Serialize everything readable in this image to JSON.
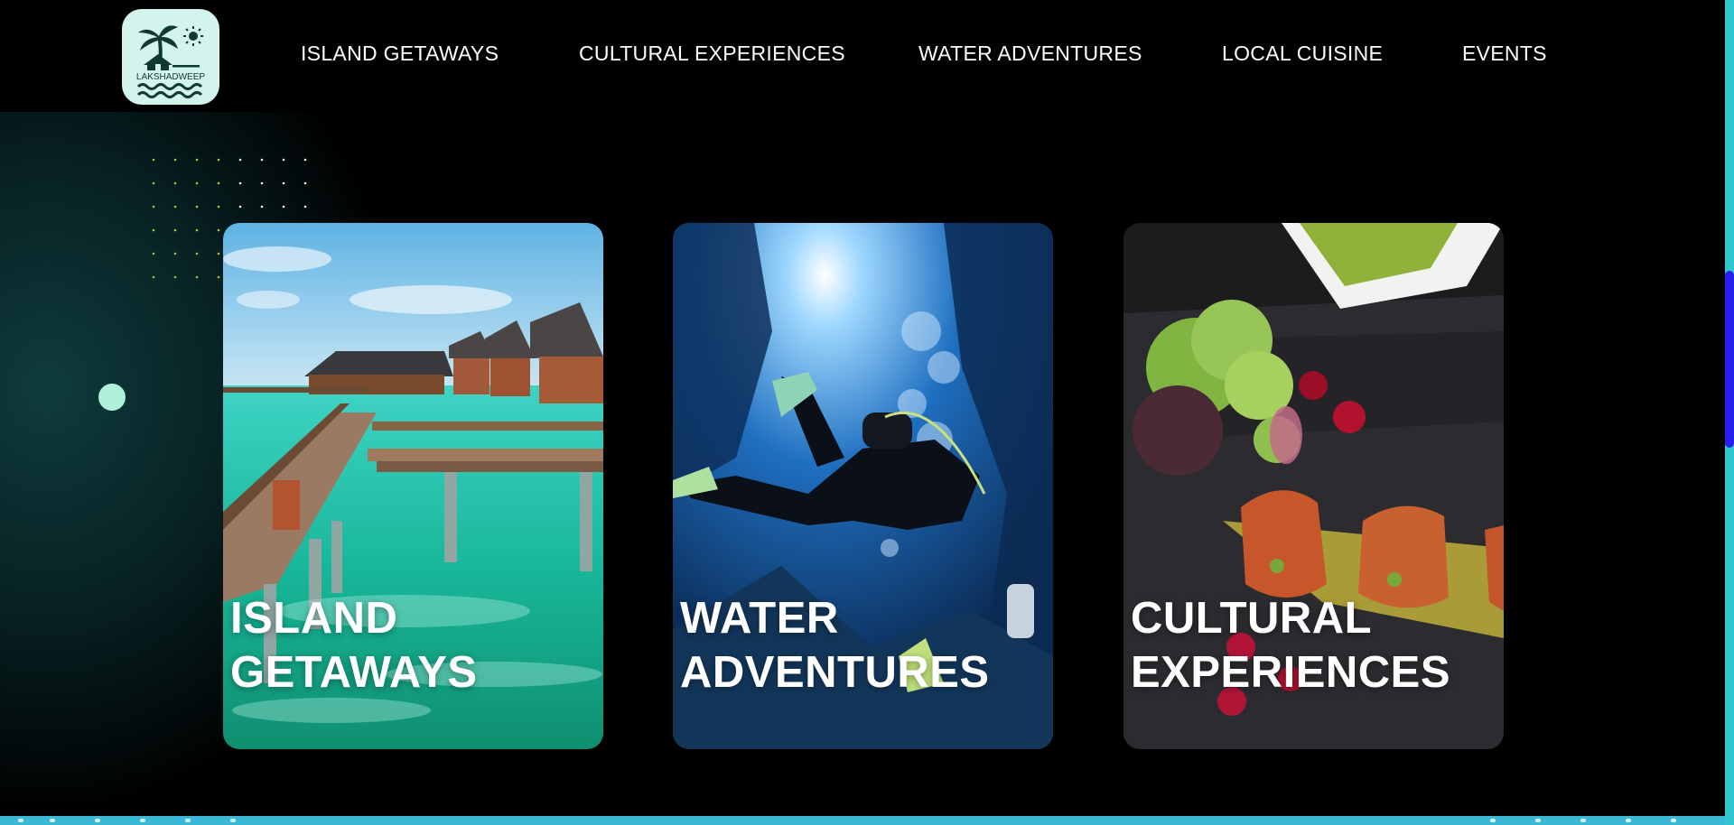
{
  "brand": {
    "logo_text": "LAKSHADWEEP"
  },
  "nav": {
    "items": [
      {
        "label": "ISLAND GETAWAYS"
      },
      {
        "label": "CULTURAL EXPERIENCES"
      },
      {
        "label": "WATER ADVENTURES"
      },
      {
        "label": "LOCAL CUISINE"
      },
      {
        "label": "EVENTS"
      }
    ]
  },
  "cards": [
    {
      "line1": "ISLAND",
      "line2": "GETAWAYS",
      "image": "overwater-villas-photo"
    },
    {
      "line1": "WATER",
      "line2": "ADVENTURES",
      "image": "scuba-diver-photo"
    },
    {
      "line1": "CULTURAL",
      "line2": "EXPERIENCES",
      "image": "grilled-food-plate-photo"
    }
  ],
  "colors": {
    "background": "#000000",
    "accent_teal": "#32c6cf",
    "scrollbar": "#2a1df0",
    "logo_bg": "#d4f3ec",
    "deco_circle": "#aef0d8"
  }
}
